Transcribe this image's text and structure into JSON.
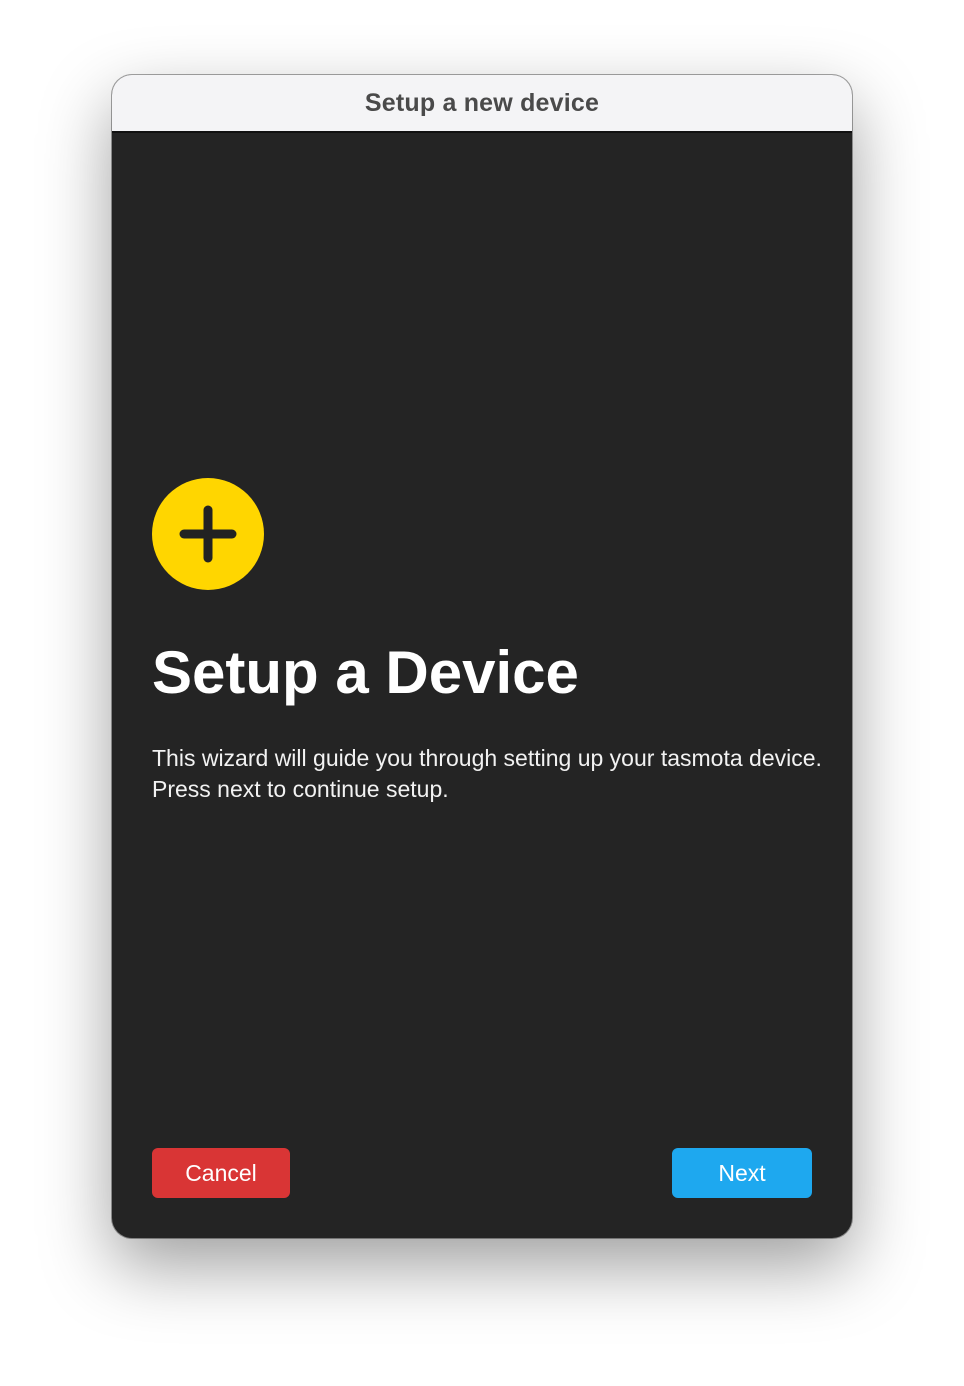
{
  "window": {
    "title": "Setup a new device"
  },
  "wizard": {
    "icon": "plus-circle-icon",
    "heading": "Setup a Device",
    "description": "This wizard will guide you through setting up your tasmota device. Press next to continue setup."
  },
  "buttons": {
    "cancel_label": "Cancel",
    "next_label": "Next"
  },
  "colors": {
    "background": "#242424",
    "titlebar": "#f4f4f6",
    "icon_accent": "#ffd600",
    "cancel": "#d93535",
    "next": "#1ea8ef"
  }
}
